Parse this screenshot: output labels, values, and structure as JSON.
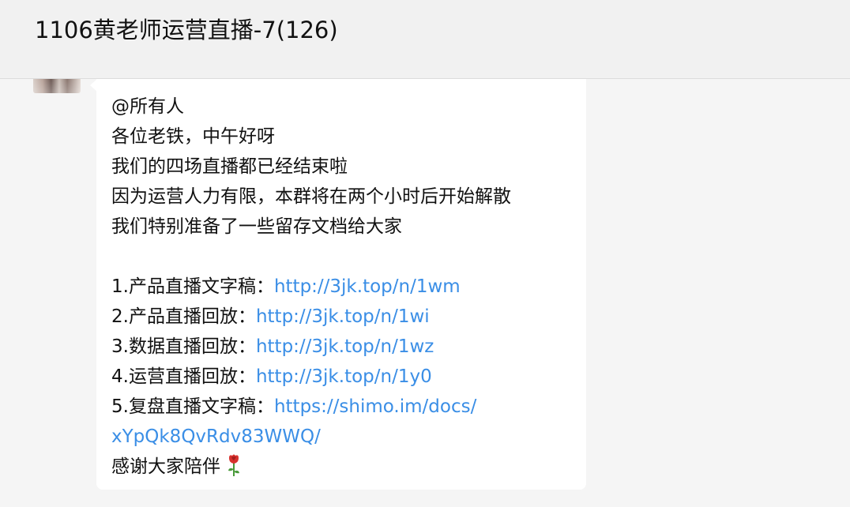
{
  "header": {
    "title": "1106黄老师运营直播-7(126)"
  },
  "message": {
    "lines": {
      "mention": "@所有人",
      "greeting": "各位老铁，中午好呀",
      "ended": "我们的四场直播都已经结束啦",
      "dissolve": "因为运营人力有限，本群将在两个小时后开始解散",
      "docs_intro": "我们特别准备了一些留存文档给大家"
    },
    "links": [
      {
        "label": "1.产品直播文字稿：",
        "url": "http://3jk.top/n/1wm"
      },
      {
        "label": "2.产品直播回放：",
        "url": "http://3jk.top/n/1wi"
      },
      {
        "label": "3.数据直播回放：",
        "url": "http://3jk.top/n/1wz"
      },
      {
        "label": "4.运营直播回放：",
        "url": "http://3jk.top/n/1y0"
      },
      {
        "label": "5.复盘直播文字稿：",
        "url_part1": "https://shimo.im/docs/",
        "url_part2": "xYpQk8QvRdv83WWQ/"
      }
    ],
    "closing": "感谢大家陪伴",
    "closing_icon": "rose-icon"
  },
  "colors": {
    "link": "#3a8ee6",
    "bubble": "#ffffff",
    "background": "#f5f5f5"
  }
}
